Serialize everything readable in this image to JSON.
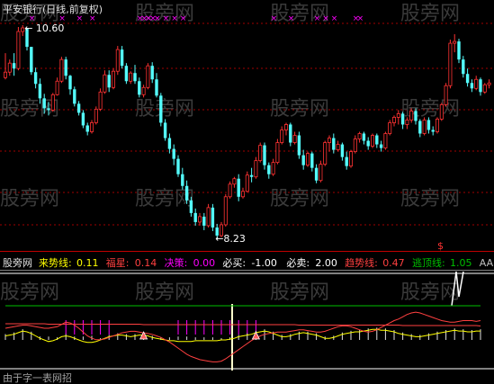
{
  "header": {
    "title": "平安银行(日线,前复权)"
  },
  "watermark": "股旁网",
  "indicator": {
    "name": "股旁网",
    "items": [
      {
        "label": "来势线:",
        "value": "0.11",
        "color": "#ffff00"
      },
      {
        "label": "福星:",
        "value": "0.14",
        "color": "#ff4040"
      },
      {
        "label": "决策:",
        "value": "0.00",
        "color": "#ff00ff"
      },
      {
        "label": "必买:",
        "value": "-1.00",
        "color": "#ffffff"
      },
      {
        "label": "必卖:",
        "value": "2.00",
        "color": "#ffffff"
      },
      {
        "label": "趋势线:",
        "value": "0.47",
        "color": "#ff4040"
      },
      {
        "label": "逃顶线:",
        "value": "1.05",
        "color": "#00c000"
      },
      {
        "label": "AA:",
        "value": "0",
        "color": "#c0c0c0"
      }
    ]
  },
  "footer": {
    "text": "由于字一表网招"
  },
  "colors": {
    "up": "#ff3232",
    "down": "#54fcfc",
    "grid": "#a00000",
    "magenta": "#ff00ff"
  },
  "chart_data": [
    {
      "type": "candlestick",
      "title": "平安银行(日线,前复权)",
      "annotations": [
        {
          "text": "10.60",
          "kind": "high",
          "value": 10.6
        },
        {
          "text": "8.23",
          "kind": "low",
          "value": 8.23
        }
      ],
      "ohlc": [
        [
          10.02,
          10.29,
          10.0,
          10.08
        ],
        [
          10.08,
          10.22,
          10.04,
          10.18
        ],
        [
          10.18,
          10.29,
          10.04,
          10.12
        ],
        [
          10.12,
          10.58,
          10.1,
          10.53
        ],
        [
          10.53,
          10.6,
          10.48,
          10.57
        ],
        [
          10.57,
          10.57,
          10.32,
          10.36
        ],
        [
          10.36,
          10.36,
          10.05,
          10.08
        ],
        [
          10.08,
          10.13,
          9.9,
          9.95
        ],
        [
          9.95,
          10.01,
          9.73,
          9.79
        ],
        [
          9.79,
          9.84,
          9.62,
          9.68
        ],
        [
          9.68,
          9.75,
          9.6,
          9.66
        ],
        [
          9.66,
          9.85,
          9.64,
          9.83
        ],
        [
          9.83,
          10.02,
          9.82,
          9.98
        ],
        [
          9.98,
          10.25,
          9.96,
          10.22
        ],
        [
          10.22,
          10.25,
          10.0,
          10.04
        ],
        [
          10.04,
          10.05,
          9.83,
          9.89
        ],
        [
          9.89,
          9.92,
          9.7,
          9.73
        ],
        [
          9.73,
          9.76,
          9.6,
          9.63
        ],
        [
          9.63,
          9.66,
          9.46,
          9.49
        ],
        [
          9.49,
          9.52,
          9.38,
          9.42
        ],
        [
          9.42,
          9.55,
          9.4,
          9.52
        ],
        [
          9.52,
          9.7,
          9.5,
          9.67
        ],
        [
          9.67,
          9.9,
          9.65,
          9.86
        ],
        [
          9.86,
          10.1,
          9.84,
          10.05
        ],
        [
          10.05,
          10.1,
          9.86,
          9.91
        ],
        [
          9.91,
          10.12,
          9.89,
          10.09
        ],
        [
          10.09,
          10.37,
          10.05,
          10.33
        ],
        [
          10.33,
          10.37,
          10.12,
          10.15
        ],
        [
          10.15,
          10.18,
          9.95,
          9.98
        ],
        [
          9.98,
          10.09,
          9.95,
          10.07
        ],
        [
          10.07,
          10.16,
          9.95,
          9.98
        ],
        [
          9.98,
          10.02,
          9.8,
          9.83
        ],
        [
          9.83,
          9.94,
          9.8,
          9.91
        ],
        [
          9.91,
          10.18,
          9.89,
          10.15
        ],
        [
          10.15,
          10.19,
          9.96,
          10.0
        ],
        [
          10.0,
          10.07,
          9.8,
          9.82
        ],
        [
          9.82,
          9.85,
          9.48,
          9.52
        ],
        [
          9.52,
          9.56,
          9.32,
          9.35
        ],
        [
          9.35,
          9.4,
          9.18,
          9.23
        ],
        [
          9.23,
          9.28,
          9.05,
          9.12
        ],
        [
          9.12,
          9.16,
          8.92,
          8.95
        ],
        [
          8.95,
          9.02,
          8.78,
          8.82
        ],
        [
          8.82,
          8.88,
          8.62,
          8.66
        ],
        [
          8.66,
          8.7,
          8.48,
          8.52
        ],
        [
          8.52,
          8.57,
          8.38,
          8.42
        ],
        [
          8.42,
          8.52,
          8.38,
          8.48
        ],
        [
          8.48,
          8.52,
          8.33,
          8.38
        ],
        [
          8.38,
          8.62,
          8.36,
          8.58
        ],
        [
          8.58,
          8.62,
          8.32,
          8.36
        ],
        [
          8.36,
          8.4,
          8.23,
          8.27
        ],
        [
          8.27,
          8.42,
          8.25,
          8.39
        ],
        [
          8.39,
          8.73,
          8.37,
          8.7
        ],
        [
          8.7,
          8.87,
          8.68,
          8.84
        ],
        [
          8.84,
          8.92,
          8.8,
          8.9
        ],
        [
          8.9,
          8.95,
          8.65,
          8.7
        ],
        [
          8.7,
          8.8,
          8.68,
          8.76
        ],
        [
          8.76,
          8.98,
          8.75,
          8.94
        ],
        [
          8.94,
          9.02,
          8.86,
          8.92
        ],
        [
          8.92,
          9.14,
          8.9,
          9.1
        ],
        [
          9.1,
          9.3,
          9.08,
          9.27
        ],
        [
          9.27,
          9.3,
          9.0,
          9.05
        ],
        [
          9.05,
          9.08,
          8.9,
          8.95
        ],
        [
          8.95,
          9.12,
          8.93,
          9.08
        ],
        [
          9.08,
          9.34,
          9.06,
          9.3
        ],
        [
          9.3,
          9.48,
          9.28,
          9.44
        ],
        [
          9.44,
          9.52,
          9.38,
          9.5
        ],
        [
          9.5,
          9.52,
          9.26,
          9.3
        ],
        [
          9.3,
          9.42,
          9.28,
          9.38
        ],
        [
          9.38,
          9.42,
          9.12,
          9.16
        ],
        [
          9.16,
          9.22,
          9.0,
          9.05
        ],
        [
          9.05,
          9.2,
          9.03,
          9.18
        ],
        [
          9.18,
          9.2,
          8.98,
          9.02
        ],
        [
          9.02,
          9.06,
          8.85,
          8.88
        ],
        [
          8.88,
          9.1,
          8.86,
          9.06
        ],
        [
          9.06,
          9.32,
          9.04,
          9.3
        ],
        [
          9.3,
          9.38,
          9.2,
          9.35
        ],
        [
          9.35,
          9.4,
          9.18,
          9.22
        ],
        [
          9.22,
          9.32,
          9.2,
          9.28
        ],
        [
          9.28,
          9.3,
          9.1,
          9.14
        ],
        [
          9.14,
          9.2,
          9.0,
          9.04
        ],
        [
          9.04,
          9.22,
          9.02,
          9.2
        ],
        [
          9.2,
          9.38,
          9.18,
          9.34
        ],
        [
          9.34,
          9.42,
          9.3,
          9.4
        ],
        [
          9.4,
          9.42,
          9.28,
          9.32
        ],
        [
          9.32,
          9.36,
          9.22,
          9.26
        ],
        [
          9.26,
          9.4,
          9.24,
          9.38
        ],
        [
          9.38,
          9.4,
          9.24,
          9.28
        ],
        [
          9.28,
          9.32,
          9.2,
          9.24
        ],
        [
          9.24,
          9.42,
          9.22,
          9.4
        ],
        [
          9.4,
          9.55,
          9.38,
          9.52
        ],
        [
          9.52,
          9.6,
          9.48,
          9.58
        ],
        [
          9.58,
          9.66,
          9.5,
          9.62
        ],
        [
          9.62,
          9.64,
          9.45,
          9.5
        ],
        [
          9.5,
          9.58,
          9.45,
          9.55
        ],
        [
          9.55,
          9.68,
          9.52,
          9.65
        ],
        [
          9.65,
          9.68,
          9.5,
          9.54
        ],
        [
          9.54,
          9.56,
          9.36,
          9.4
        ],
        [
          9.4,
          9.58,
          9.38,
          9.55
        ],
        [
          9.55,
          9.58,
          9.4,
          9.44
        ],
        [
          9.44,
          9.48,
          9.38,
          9.42
        ],
        [
          9.42,
          9.58,
          9.4,
          9.56
        ],
        [
          9.56,
          9.74,
          9.54,
          9.72
        ],
        [
          9.72,
          9.96,
          9.7,
          9.93
        ],
        [
          9.93,
          10.44,
          9.9,
          10.4
        ],
        [
          10.4,
          10.5,
          10.3,
          10.42
        ],
        [
          10.42,
          10.45,
          10.18,
          10.22
        ],
        [
          10.22,
          10.26,
          10.02,
          10.06
        ],
        [
          10.06,
          10.12,
          9.92,
          9.96
        ],
        [
          9.96,
          10.0,
          9.86,
          9.9
        ],
        [
          9.9,
          10.04,
          9.88,
          10.0
        ],
        [
          10.0,
          10.02,
          9.82,
          9.86
        ],
        [
          9.86,
          9.96,
          9.84,
          9.94
        ],
        [
          9.94,
          10.0,
          9.9,
          9.96
        ]
      ]
    },
    {
      "type": "line",
      "title": "股旁网",
      "series": [
        {
          "name": "来势线",
          "values": [
            0.05,
            0.06,
            0.07,
            0.09,
            0.11,
            0.1,
            0.08,
            0.05,
            0.02,
            0,
            -0.02,
            -0.01,
            0.01,
            0.04,
            0.05,
            0.04,
            0.02,
            0,
            -0.02,
            -0.03,
            -0.03,
            -0.02,
            0,
            0.02,
            0.04,
            0.05,
            0.06,
            0.06,
            0.05,
            0.04,
            0.05,
            0.06,
            0.06,
            0.05,
            0.03,
            0.02,
            0.01,
            0,
            -0.01,
            -0.01,
            -0.02,
            -0.02,
            -0.02,
            -0.02,
            -0.01,
            -0.01,
            -0.01,
            -0.01,
            -0.01,
            -0.01,
            0,
            0,
            0.01,
            0.02,
            0.04,
            0.05,
            0.06,
            0.07,
            0.09,
            0.1,
            0.11,
            0.1,
            0.08,
            0.06,
            0.04,
            0.04,
            0.05,
            0.07,
            0.08,
            0.09,
            0.08,
            0.07,
            0.06,
            0.04,
            0.02,
            0.02,
            0.03,
            0.05,
            0.07,
            0.08,
            0.09,
            0.1,
            0.1,
            0.11,
            0.12,
            0.13,
            0.13,
            0.12,
            0.12,
            0.11,
            0.1,
            0.08,
            0.07,
            0.06,
            0.05,
            0.04,
            0.04,
            0.05,
            0.06,
            0.07,
            0.08,
            0.09,
            0.1,
            0.11,
            0.12,
            0.11,
            0.11,
            0.1,
            0.1,
            0.11,
            0.11
          ]
        },
        {
          "name": "福星",
          "values": [
            0.2,
            0.21,
            0.22,
            0.23,
            0.24,
            0.24,
            0.23,
            0.22,
            0.21,
            0.2,
            0.2,
            0.21,
            0.22,
            0.25,
            0.28,
            0.27,
            0.24,
            0.2,
            0.15,
            0.1,
            0.07,
            0.05,
            0.05,
            0.06,
            0.08,
            0.1,
            0.12,
            0.14,
            0.15,
            0.16,
            0.16,
            0.15,
            0.14,
            0.13,
            0.12,
            0.1,
            0.08,
            0.05,
            0.02,
            -0.02,
            -0.06,
            -0.1,
            -0.14,
            -0.17,
            -0.19,
            -0.21,
            -0.22,
            -0.23,
            -0.24,
            -0.24,
            -0.23,
            -0.2,
            -0.16,
            -0.12,
            -0.08,
            -0.04,
            0,
            0.04,
            0.07,
            0.1,
            0.12,
            0.13,
            0.14,
            0.15,
            0.15,
            0.15,
            0.16,
            0.17,
            0.18,
            0.18,
            0.17,
            0.16,
            0.15,
            0.15,
            0.16,
            0.18,
            0.2,
            0.22,
            0.23,
            0.23,
            0.22,
            0.2,
            0.18,
            0.16,
            0.15,
            0.16,
            0.18,
            0.21,
            0.24,
            0.27,
            0.3,
            0.32,
            0.35,
            0.38,
            0.4,
            0.41,
            0.4,
            0.38,
            0.36,
            0.34,
            0.32,
            0.3,
            0.29,
            0.28,
            0.28,
            0.29,
            0.3,
            0.3,
            0.3,
            0.29,
            0.3
          ]
        },
        {
          "name": "趋势线",
          "values": [
            0.52,
            0.52,
            0.52,
            0.52,
            0.52,
            0.52,
            0.52,
            0.52,
            0.52,
            0.52,
            0.51,
            0.51,
            0.51,
            0.51,
            0.51,
            0.51,
            0.51,
            0.51,
            0.51,
            0.51,
            0.51,
            0.51,
            0.51,
            0.51,
            0.51,
            0.51,
            0.51,
            0.51,
            0.51,
            0.51,
            0.51,
            0.51,
            0.5,
            0.5,
            0.5,
            0.5,
            0.5,
            0.5,
            0.5,
            0.5,
            0.5,
            0.5,
            0.5,
            0.5,
            0.5,
            0.5,
            0.5,
            0.5,
            0.5,
            0.5,
            0.5,
            0.5,
            0.5,
            0.5,
            0.5,
            0.5,
            0.5,
            0.5,
            0.5,
            0.5,
            0.5,
            0.5,
            0.5,
            0.5,
            0.5,
            0.5,
            0.5,
            0.5,
            0.49,
            0.49,
            0.49,
            0.49,
            0.49,
            0.49,
            0.49,
            0.49,
            0.49,
            0.49,
            0.49,
            0.49,
            0.49,
            0.49,
            0.49,
            0.49,
            0.49,
            0.49,
            0.49,
            0.49,
            0.49,
            0.49,
            0.49,
            0.49,
            0.48,
            0.48,
            0.48,
            0.48,
            0.48,
            0.48,
            0.48,
            0.48,
            0.48,
            0.48,
            0.48,
            0.48,
            0.48,
            0.48,
            0.48,
            0.48,
            0.48,
            0.48,
            0.47
          ]
        },
        {
          "name": "逃顶线",
          "values": [
            1.05,
            1.05,
            1.05,
            1.05,
            1.05,
            1.05,
            1.05,
            1.05,
            1.05,
            1.05,
            1.05,
            1.05,
            1.05,
            1.05,
            1.05,
            1.05,
            1.05,
            1.05,
            1.05,
            1.05,
            1.05,
            1.05,
            1.05,
            1.05,
            1.05,
            1.05,
            1.05,
            1.05,
            1.05,
            1.05,
            1.05,
            1.05,
            1.05,
            1.05,
            1.05,
            1.05,
            1.05,
            1.05,
            1.05,
            1.05,
            1.05,
            1.05,
            1.05,
            1.05,
            1.05,
            1.05,
            1.05,
            1.05,
            1.05,
            1.05,
            1.05,
            1.05,
            1.05,
            1.05,
            1.05,
            1.05,
            1.05,
            1.05,
            1.05,
            1.05,
            1.05,
            1.05,
            1.05,
            1.05,
            1.05,
            1.05,
            1.05,
            1.05,
            1.05,
            1.05,
            1.05,
            1.05,
            1.05,
            1.05,
            1.05,
            1.05,
            1.05,
            1.05,
            1.05,
            1.05,
            1.05,
            1.05,
            1.05,
            1.05,
            1.05,
            1.05,
            1.05,
            1.05,
            1.05,
            1.05,
            1.05,
            1.05,
            1.05,
            1.05,
            1.05,
            1.05,
            1.05,
            1.05,
            1.05,
            1.05,
            1.05,
            1.05,
            1.05,
            1.05,
            1.05,
            1.05,
            1.05,
            1.05,
            1.05,
            1.05,
            1.05
          ]
        }
      ],
      "reference_lines": [
        {
          "name": "必买",
          "value": -1.0
        },
        {
          "name": "必卖",
          "value": 2.0
        }
      ]
    }
  ]
}
